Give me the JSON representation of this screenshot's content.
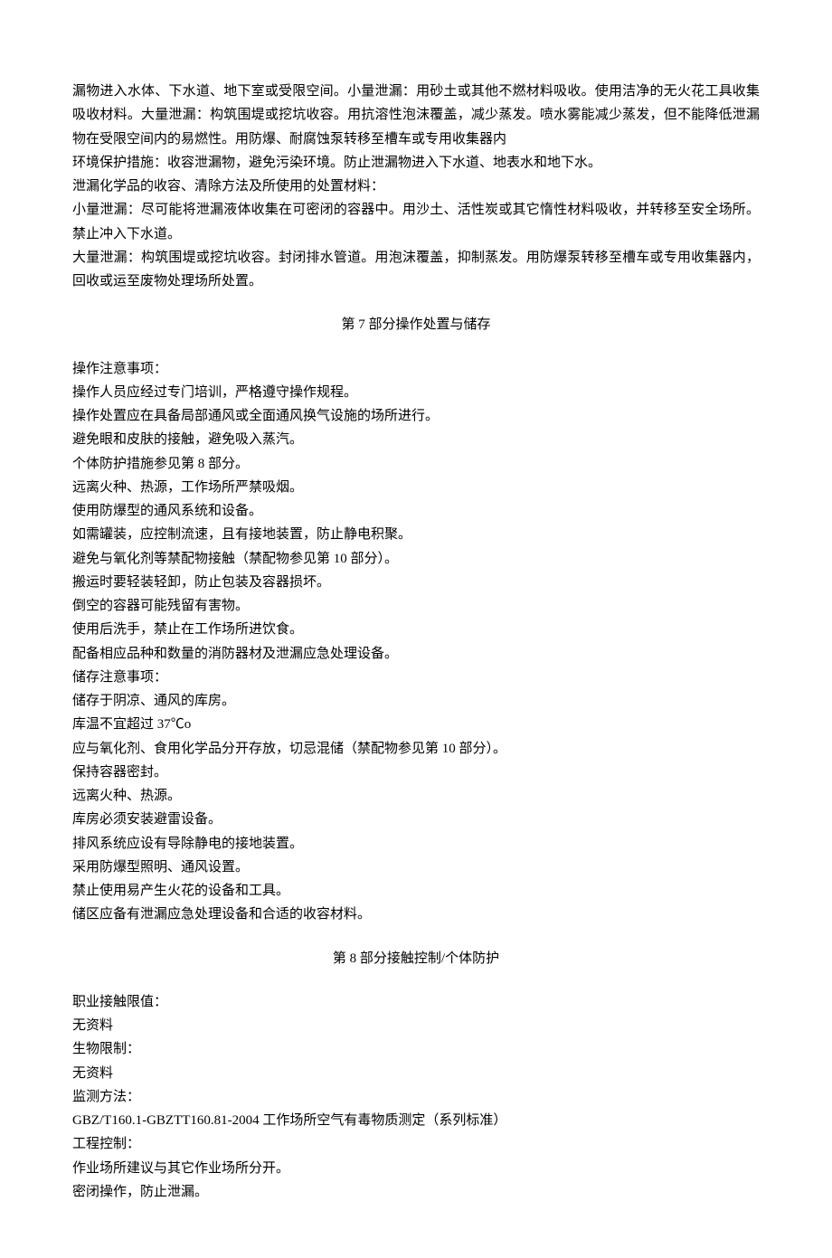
{
  "intro": {
    "p1": "漏物进入水体、下水道、地下室或受限空间。小量泄漏：用砂土或其他不燃材料吸收。使用洁净的无火花工具收集吸收材料。大量泄漏：构筑围堤或挖坑收容。用抗溶性泡沫覆盖，减少蒸发。喷水雾能减少蒸发，但不能降低泄漏物在受限空间内的易燃性。用防爆、耐腐蚀泵转移至槽车或专用收集器内",
    "p2": "环境保护措施：收容泄漏物，避免污染环境。防止泄漏物进入下水道、地表水和地下水。",
    "p3": "泄漏化学品的收容、清除方法及所使用的处置材料：",
    "p4": "小量泄漏：尽可能将泄漏液体收集在可密闭的容器中。用沙土、活性炭或其它惰性材料吸收，并转移至安全场所。禁止冲入下水道。",
    "p5": "大量泄漏：构筑围堤或挖坑收容。封闭排水管道。用泡沫覆盖，抑制蒸发。用防爆泵转移至槽车或专用收集器内，回收或运至废物处理场所处置。"
  },
  "section7": {
    "title": "第 7 部分操作处置与储存",
    "op_label": "操作注意事项：",
    "op1": "操作人员应经过专门培训，严格遵守操作规程。",
    "op2": "操作处置应在具备局部通风或全面通风换气设施的场所进行。",
    "op3": "避免眼和皮肤的接触，避免吸入蒸汽。",
    "op4": "个体防护措施参见第 8 部分。",
    "op5": "远离火种、热源，工作场所严禁吸烟。",
    "op6": "使用防爆型的通风系统和设备。",
    "op7": "如需罐装，应控制流速，且有接地装置，防止静电积聚。",
    "op8": "避免与氧化剂等禁配物接触（禁配物参见第 10 部分）。",
    "op9": "搬运时要轻装轻卸，防止包装及容器损坏。",
    "op10": "倒空的容器可能残留有害物。",
    "op11": "使用后洗手，禁止在工作场所进饮食。",
    "op12": "配备相应品种和数量的消防器材及泄漏应急处理设备。",
    "st_label": "储存注意事项：",
    "st1": "储存于阴凉、通风的库房。",
    "st2": "库温不宜超过 37℃o",
    "st3": "应与氧化剂、食用化学品分开存放，切忌混储（禁配物参见第 10 部分）。",
    "st4": "保持容器密封。",
    "st5": "远离火种、热源。",
    "st6": "库房必须安装避雷设备。",
    "st7": "排风系统应设有导除静电的接地装置。",
    "st8": "采用防爆型照明、通风设置。",
    "st9": "禁止使用易产生火花的设备和工具。",
    "st10": "储区应备有泄漏应急处理设备和合适的收容材料。"
  },
  "section8": {
    "title": "第 8 部分接触控制/个体防护",
    "l1": "职业接触限值：",
    "l2": "无资料",
    "l3": "生物限制：",
    "l4": "无资料",
    "l5": "监测方法：",
    "l6": "GBZ/T160.1-GBZTT160.81-2004 工作场所空气有毒物质测定（系列标准）",
    "l7": "工程控制：",
    "l8": "作业场所建议与其它作业场所分开。",
    "l9": "密闭操作，防止泄漏。"
  }
}
